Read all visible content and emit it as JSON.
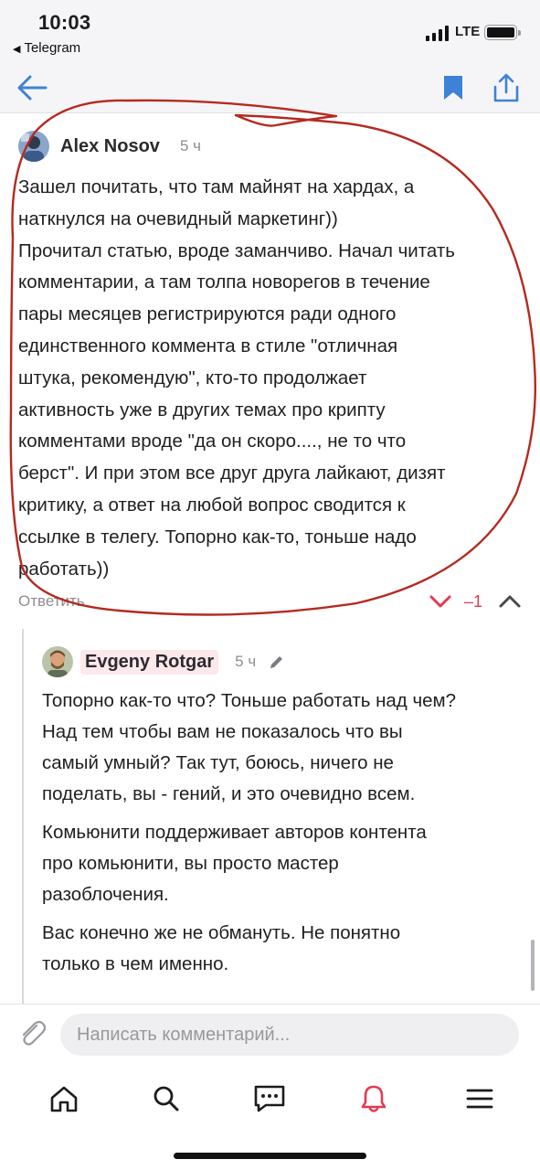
{
  "status_bar": {
    "time": "10:03",
    "back_app": "Telegram",
    "network": "LTE"
  },
  "nav": {
    "back_icon": "arrow-left-icon",
    "bookmark_icon": "bookmark-icon",
    "share_icon": "share-icon",
    "accent_color": "#3d82d6"
  },
  "comment": {
    "author": "Alex Nosov",
    "time_ago": "5 ч",
    "lines": [
      "Зашел почитать, что там майнят на хардах, а",
      "наткнулся на очевидный маркетинг))",
      "Прочитал статью, вроде заманчиво. Начал читать",
      "комментарии, а там толпа новорегов в течение",
      "пары месяцев регистрируются ради одного",
      "единственного коммента в стиле \"отличная",
      "штука, рекомендую\", кто-то продолжает",
      "активность уже в других темах про крипту",
      "комментами вроде \"да он скоро...., не то что",
      "берст\". И при этом все друг друга лайкают, дизят",
      "критику, а ответ на любой вопрос сводится к",
      "ссылке в телегу. Топорно как-то, тоньше надо",
      "работать))"
    ],
    "reply_label": "Ответить",
    "score": "–1",
    "score_color": "#e53950"
  },
  "reply": {
    "author": "Evgeny Rotgar",
    "time_ago": "5 ч",
    "paragraphs": [
      [
        "Топорно как-то что? Тоньше работать над чем?",
        "Над тем чтобы вам не показалось что вы",
        "самый умный? Так тут, боюсь, ничего не",
        "поделать, вы - гений, и это очевидно всем."
      ],
      [
        "Комьюнити поддерживает авторов контента",
        "про комьюнити, вы просто мастер",
        "разоблочения."
      ],
      [
        "Вас конечно же не обмануть. Не понятно",
        "только в чем именно."
      ]
    ]
  },
  "composer": {
    "placeholder": "Написать комментарий..."
  },
  "tabbar": {
    "items": [
      "home-icon",
      "search-icon",
      "chat-icon",
      "bell-icon",
      "menu-icon"
    ],
    "active_color": "#e53950"
  },
  "annotation_color": "#b52a1f"
}
